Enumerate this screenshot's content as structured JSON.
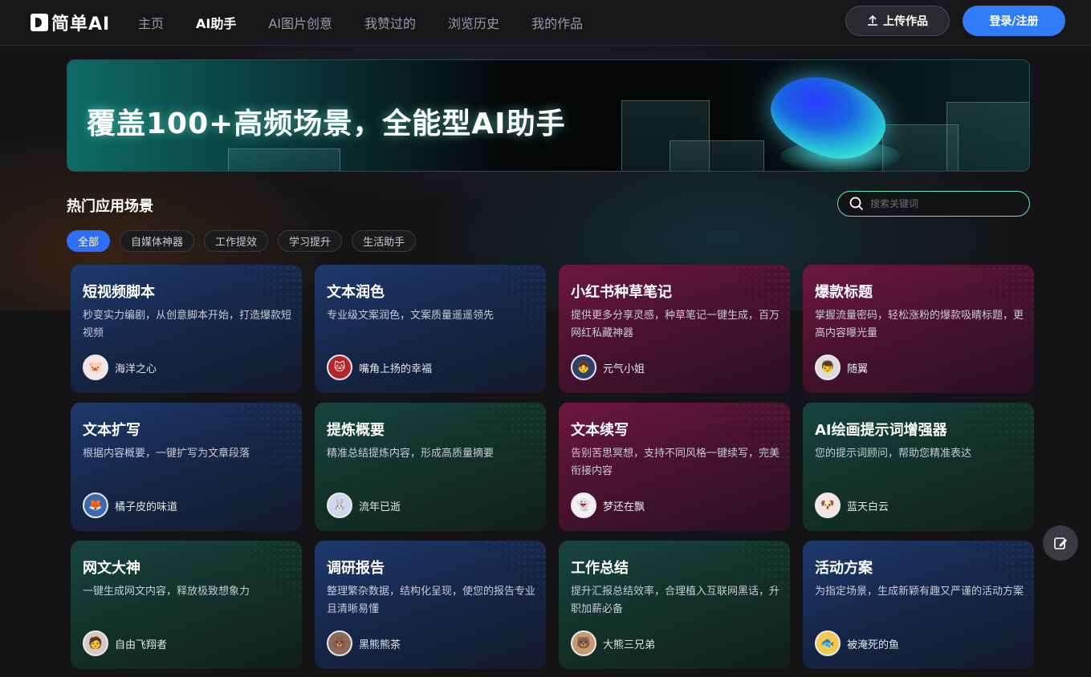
{
  "header": {
    "logo_text": "简单AI",
    "nav": [
      {
        "label": "主页",
        "active": false
      },
      {
        "label": "AI助手",
        "active": true
      },
      {
        "label": "AI图片创意",
        "active": false
      },
      {
        "label": "我赞过的",
        "active": false
      },
      {
        "label": "浏览历史",
        "active": false
      },
      {
        "label": "我的作品",
        "active": false
      }
    ],
    "upload_label": "上传作品",
    "login_label": "登录/注册"
  },
  "banner": {
    "title": "覆盖100+高频场景，全能型AI助手"
  },
  "section": {
    "title": "热门应用场景",
    "search_placeholder": "搜索关键词",
    "filters": [
      {
        "label": "全部",
        "active": true
      },
      {
        "label": "自媒体神器",
        "active": false
      },
      {
        "label": "工作提效",
        "active": false
      },
      {
        "label": "学习提升",
        "active": false
      },
      {
        "label": "生活助手",
        "active": false
      }
    ]
  },
  "cards": [
    {
      "title": "短视频脚本",
      "desc": "秒变实力编剧，从创意脚本开始，打造爆款短视频",
      "author": "海洋之心",
      "theme": "blue",
      "avatar_icon": "pig-avatar-icon",
      "avatar_bg": "#f3e6e6",
      "glyph": "🐷"
    },
    {
      "title": "文本润色",
      "desc": "专业级文案润色，文案质量遥遥领先",
      "author": "嘴角上扬的幸福",
      "theme": "blue",
      "avatar_icon": "cat-avatar-icon",
      "avatar_bg": "#b5242a",
      "glyph": "🐱"
    },
    {
      "title": "小红书种草笔记",
      "desc": "提供更多分享灵感，种草笔记一键生成，百万网红私藏神器",
      "author": "元气小姐",
      "theme": "red",
      "avatar_icon": "girl-avatar-icon",
      "avatar_bg": "#2b3f73",
      "glyph": "👧"
    },
    {
      "title": "爆款标题",
      "desc": "掌握流量密码，轻松涨粉的爆款吸睛标题，更高内容曝光量",
      "author": "随翼",
      "theme": "red",
      "avatar_icon": "boy-avatar-icon",
      "avatar_bg": "#dcdcdc",
      "glyph": "👦"
    },
    {
      "title": "文本扩写",
      "desc": "根据内容概要，一键扩写为文章段落",
      "author": "橘子皮的味道",
      "theme": "blue",
      "avatar_icon": "character-avatar-icon",
      "avatar_bg": "#3a6ab0",
      "glyph": "🦊"
    },
    {
      "title": "提炼概要",
      "desc": "精准总结提炼内容，形成高质量摘要",
      "author": "流年已逝",
      "theme": "green",
      "avatar_icon": "rabbit-avatar-icon",
      "avatar_bg": "#cfd6ee",
      "glyph": "🐰"
    },
    {
      "title": "文本续写",
      "desc": "告别苦思冥想，支持不同风格一键续写，完美衔接内容",
      "author": "梦还在飘",
      "theme": "red",
      "avatar_icon": "ghost-avatar-icon",
      "avatar_bg": "#f0f0f4",
      "glyph": "👻"
    },
    {
      "title": "AI绘画提示词增强器",
      "desc": "您的提示词顾问，帮助您精准表达",
      "author": "蓝天白云",
      "theme": "green",
      "avatar_icon": "dog-avatar-icon",
      "avatar_bg": "#f2e4e0",
      "glyph": "🐶"
    },
    {
      "title": "网文大神",
      "desc": "一键生成网文内容，释放极致想象力",
      "author": "自由飞翔者",
      "theme": "green",
      "avatar_icon": "person-avatar-icon",
      "avatar_bg": "#d8c8c0",
      "glyph": "🧑"
    },
    {
      "title": "调研报告",
      "desc": "整理繁杂数据，结构化呈现，使您的报告专业且清晰易懂",
      "author": "黑熊熊茶",
      "theme": "blue",
      "avatar_icon": "bear-avatar-icon",
      "avatar_bg": "#8a6a5a",
      "glyph": "🐻"
    },
    {
      "title": "工作总结",
      "desc": "提升汇报总结效率，合理植入互联网黑话，升职加薪必备",
      "author": "大熊三兄弟",
      "theme": "green",
      "avatar_icon": "bear-brothers-avatar-icon",
      "avatar_bg": "#c89a70",
      "glyph": "🐻"
    },
    {
      "title": "活动方案",
      "desc": "为指定场景，生成新颖有趣又严谨的活动方案",
      "author": "被淹死的鱼",
      "theme": "blue",
      "avatar_icon": "fish-avatar-icon",
      "avatar_bg": "#f2c94c",
      "glyph": "🐟"
    }
  ]
}
